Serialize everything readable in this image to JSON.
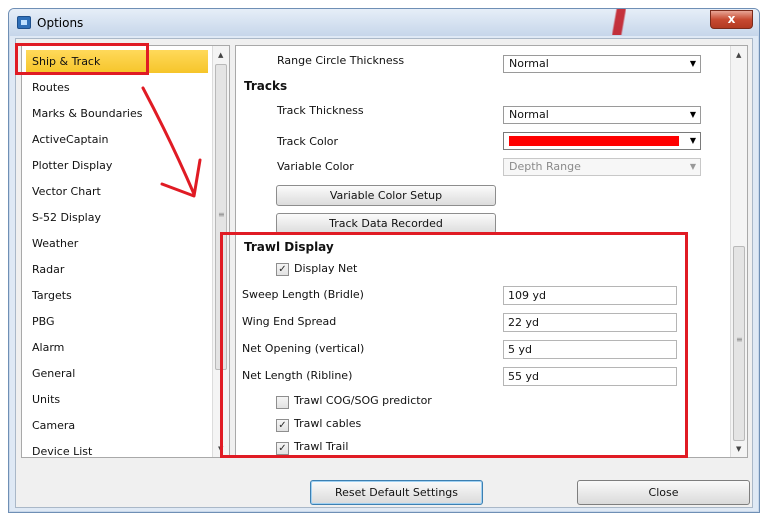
{
  "window": {
    "title": "Options",
    "close_glyph": "x"
  },
  "sidebar": {
    "items": [
      {
        "label": "Ship & Track",
        "selected": true
      },
      {
        "label": "Routes"
      },
      {
        "label": "Marks & Boundaries"
      },
      {
        "label": "ActiveCaptain"
      },
      {
        "label": "Plotter Display"
      },
      {
        "label": "Vector Chart"
      },
      {
        "label": "S-52 Display"
      },
      {
        "label": "Weather"
      },
      {
        "label": "Radar"
      },
      {
        "label": "Targets"
      },
      {
        "label": "PBG"
      },
      {
        "label": "Alarm"
      },
      {
        "label": "General"
      },
      {
        "label": "Units"
      },
      {
        "label": "Camera"
      },
      {
        "label": "Device List"
      }
    ]
  },
  "settings": {
    "range_circle_thickness": {
      "label": "Range Circle Thickness",
      "value": "Normal"
    },
    "tracks_header": "Tracks",
    "track_thickness": {
      "label": "Track Thickness",
      "value": "Normal"
    },
    "track_color": {
      "label": "Track Color",
      "value_color": "#ff0000"
    },
    "variable_color": {
      "label": "Variable Color",
      "value": "Depth Range"
    },
    "variable_color_setup_button": "Variable Color Setup",
    "track_data_recorded_button": "Track Data Recorded",
    "trawl_header": "Trawl Display",
    "display_net": {
      "label": "Display Net",
      "checked": true
    },
    "sweep_length": {
      "label": "Sweep Length (Bridle)",
      "value": "109 yd"
    },
    "wing_end_spread": {
      "label": "Wing End Spread",
      "value": "22 yd"
    },
    "net_opening": {
      "label": "Net Opening (vertical)",
      "value": "5 yd"
    },
    "net_length": {
      "label": "Net Length (Ribline)",
      "value": "55 yd"
    },
    "trawl_cog_sog": {
      "label": "Trawl COG/SOG predictor",
      "checked": false
    },
    "trawl_cables": {
      "label": "Trawl cables",
      "checked": true
    },
    "trawl_trail": {
      "label": "Trawl Trail",
      "checked": true
    }
  },
  "footer": {
    "reset_button": "Reset Default Settings",
    "close_button": "Close"
  },
  "colors": {
    "annotation_red": "#e01b24",
    "selected_item": "#f6c52a",
    "window_frame": "#dfe9f5"
  },
  "glyphs": {
    "check": "✓",
    "dropdown": "▼",
    "scroll_up": "▲",
    "scroll_down": "▼"
  }
}
